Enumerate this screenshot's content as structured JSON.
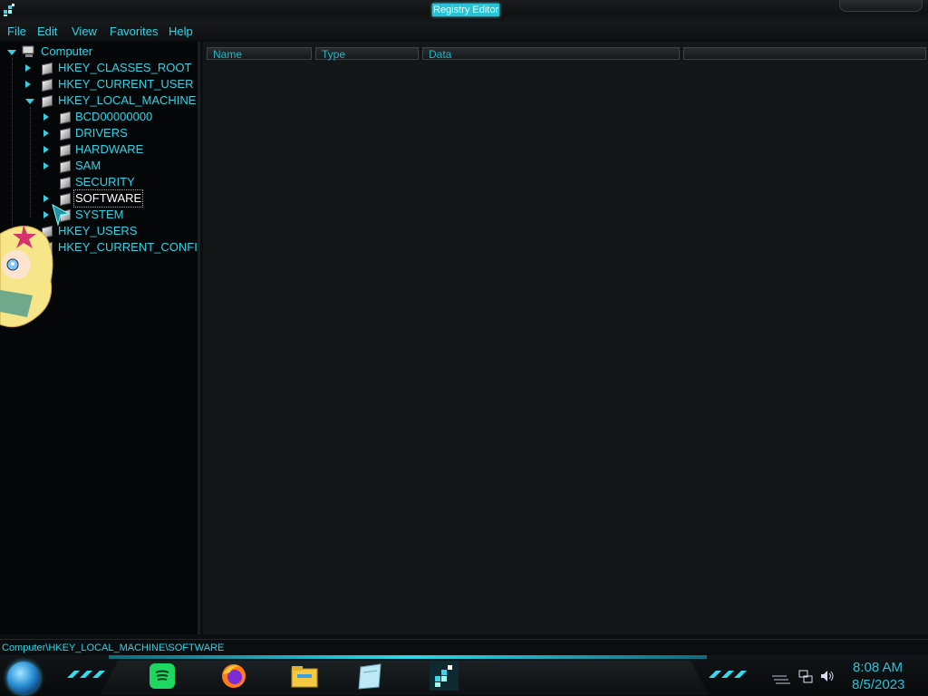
{
  "window": {
    "title": "Registry Editor"
  },
  "menu": {
    "items": [
      "File",
      "Edit",
      "View",
      "Favorites",
      "Help"
    ]
  },
  "tree": {
    "root": "Computer",
    "hives": [
      "HKEY_CLASSES_ROOT",
      "HKEY_CURRENT_USER",
      "HKEY_LOCAL_MACHINE",
      "HKEY_USERS",
      "HKEY_CURRENT_CONFI"
    ],
    "local_machine_keys": [
      "BCD00000000",
      "DRIVERS",
      "HARDWARE",
      "SAM",
      "SECURITY",
      "SOFTWARE",
      "SYSTEM"
    ],
    "selected": "SOFTWARE"
  },
  "list": {
    "columns": [
      "Name",
      "Type",
      "Data"
    ]
  },
  "status": {
    "path": "Computer\\HKEY_LOCAL_MACHINE\\SOFTWARE"
  },
  "taskbar": {
    "apps": [
      "spotify-icon",
      "firefox-icon",
      "file-explorer-icon",
      "notepad-icon",
      "registry-editor-icon"
    ],
    "clock": {
      "time": "8:08 AM",
      "date": "8/5/2023"
    }
  },
  "colors": {
    "accent": "#2fd4e6",
    "background": "#0b0d0e",
    "list_bg": "#131717"
  }
}
